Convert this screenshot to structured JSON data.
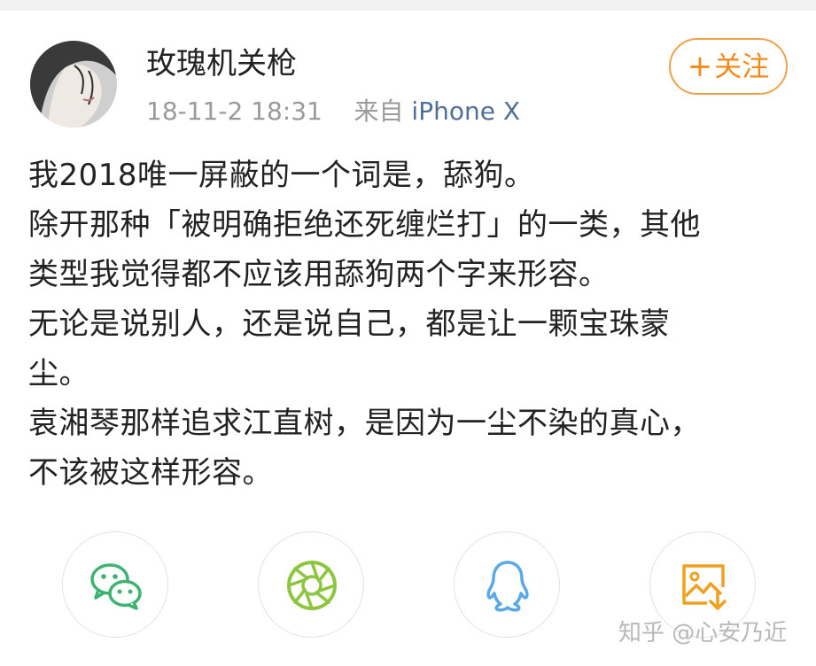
{
  "post": {
    "username": "玫瑰机关枪",
    "datetime": "18-11-2 18:31",
    "source_prefix": "来自",
    "source_device": "iPhone X",
    "follow_plus": "+",
    "follow_label": "关注",
    "lines": [
      "我2018唯一屏蔽的一个词是，舔狗。",
      "除开那种「被明确拒绝还死缠烂打」的一类，其他",
      "类型我觉得都不应该用舔狗两个字来形容。",
      "无论是说别人，还是说自己，都是让一颗宝珠蒙",
      "尘。",
      "袁湘琴那样追求江直树，是因为一尘不染的真心，",
      "不该被这样形容。"
    ]
  },
  "share": {
    "icons": [
      "wechat-icon",
      "moments-icon",
      "qq-icon",
      "save-image-icon"
    ]
  },
  "watermark": "知乎 @心安乃近",
  "colors": {
    "follow": "#f08a1c",
    "device_link": "#4e6f96",
    "meta_gray": "#9a9a9a",
    "wechat": "#3cb371",
    "moments": "#8cc63f",
    "qq": "#5aa9e6",
    "save": "#f0a020"
  }
}
